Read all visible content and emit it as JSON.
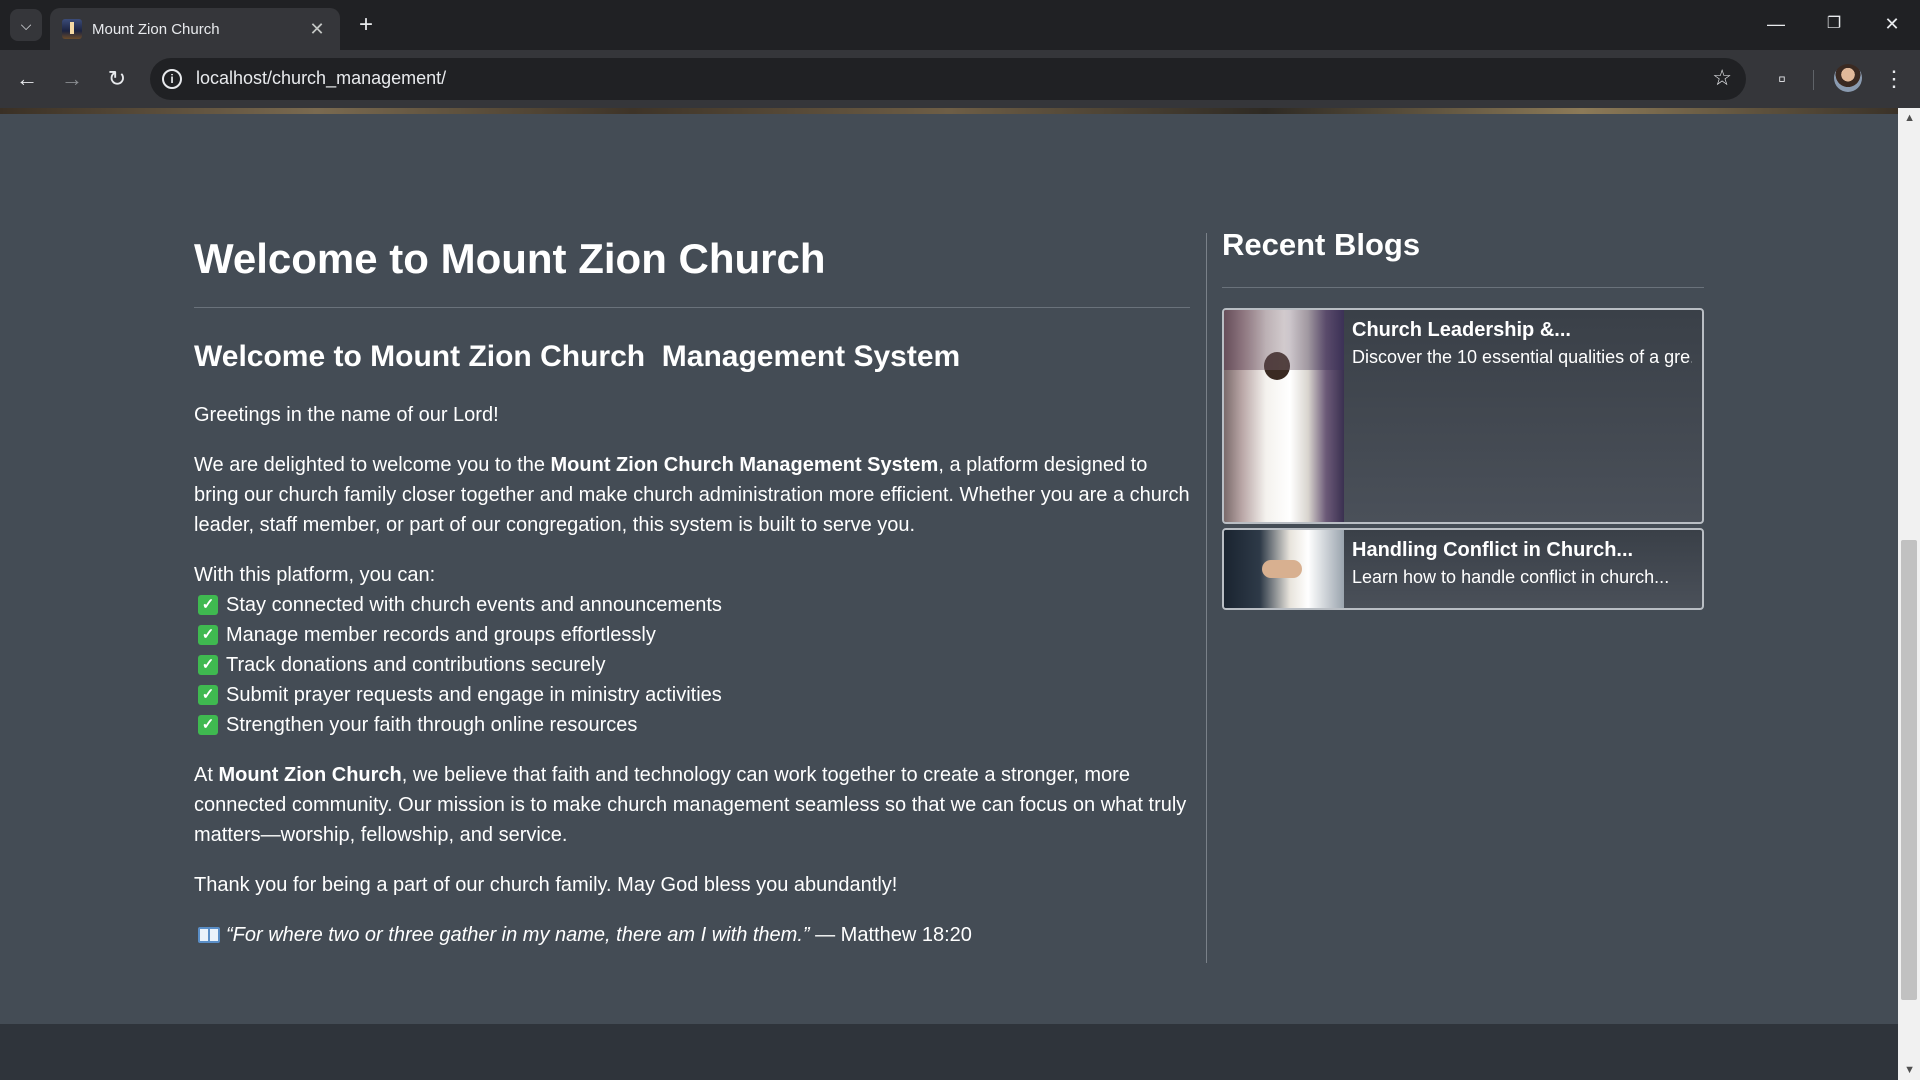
{
  "browser": {
    "tab_title": "Mount Zion Church",
    "url": "localhost/church_management/",
    "new_tab": "+",
    "tab_close": "✕",
    "minimize": "—",
    "restore": "❐",
    "close": "✕"
  },
  "page": {
    "title": "Welcome to Mount Zion Church",
    "subtitle_prefix": "Welcome to ",
    "subtitle_bold": "Mount Zion Church",
    "subtitle_suffix": "  Management System",
    "greeting": "Greetings in the name of our Lord!",
    "intro_prefix": "We are delighted to welcome you to the ",
    "intro_bold": "Mount Zion Church Management System",
    "intro_suffix": ", a platform designed to bring our church family closer together and make church administration more efficient. Whether you are a church leader, staff member, or part of our congregation, this system is built to serve you.",
    "list_intro": "With this platform, you can:",
    "features": [
      "Stay connected with church events and announcements",
      "Manage member records and groups effortlessly",
      "Track donations and contributions securely",
      "Submit prayer requests and engage in ministry activities",
      "Strengthen your faith through online resources"
    ],
    "mission_prefix": "At ",
    "mission_bold": "Mount Zion Church",
    "mission_suffix": ", we believe that faith and technology can work together to create a stronger, more connected community. Our mission is to make church management seamless so that we can focus on what truly matters—worship, fellowship, and service.",
    "thanks": "Thank you for being a part of our church family. May God bless you abundantly!",
    "verse_quote": "“For where two or three gather in my name, there am I with them.”",
    "verse_ref": " — Matthew 18:20"
  },
  "sidebar": {
    "title": "Recent Blogs",
    "blogs": [
      {
        "title": "Church Leadership &...",
        "desc": "Discover the 10 essential qualities of a gre..."
      },
      {
        "title": "Handling Conflict in Church...",
        "desc": "Learn how to handle conflict in church..."
      }
    ]
  },
  "colors": {
    "page_bg": "#444c55",
    "check": "#3fb950",
    "footer": "#2f343b"
  },
  "icons": [
    "tab-search-icon",
    "back-icon",
    "forward-icon",
    "reload-icon",
    "info-icon",
    "star-icon",
    "extensions-icon",
    "menu-icon",
    "check-icon",
    "book-icon"
  ]
}
